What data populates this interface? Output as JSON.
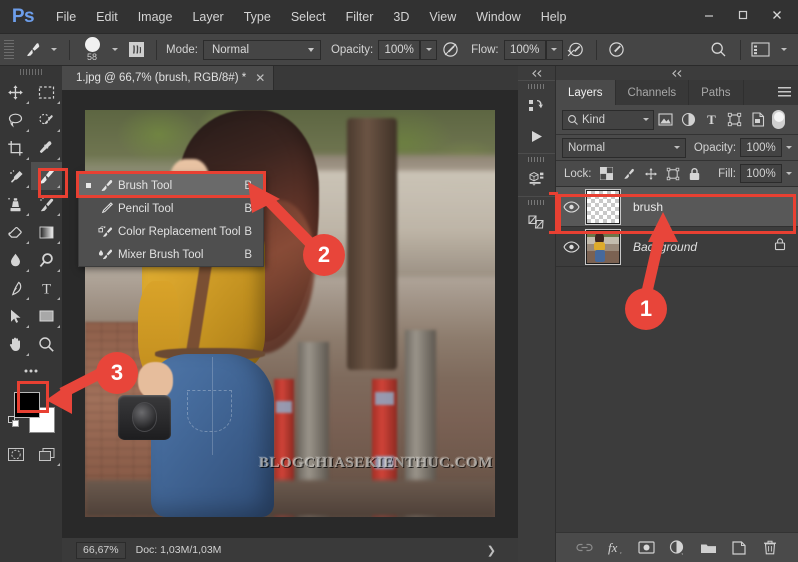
{
  "app": {
    "logo": "Ps",
    "menus": [
      "File",
      "Edit",
      "Image",
      "Layer",
      "Type",
      "Select",
      "Filter",
      "3D",
      "View",
      "Window",
      "Help"
    ],
    "window_controls": {
      "minimize": "–",
      "maximize": "□",
      "close": "✕"
    },
    "accent_red": "#e8453a",
    "panel_bg": "#3c3c3c",
    "toolbar_bg": "#363636"
  },
  "options_bar": {
    "tool_icon": "brush-tool-icon",
    "brush_size": "58",
    "brush_panel_icon": "brush-panel-icon",
    "mode_label": "Mode:",
    "mode_value": "Normal",
    "opacity_label": "Opacity:",
    "opacity_value": "100%",
    "airbrush_icon": "airbrush-icon",
    "flow_label": "Flow:",
    "flow_value": "100%",
    "smoothing_icon": "smoothing-icon",
    "tablet_pressure_icon": "tablet-pressure-icon",
    "symmetry_icon": "symmetry-icon",
    "search_icon": "search-icon",
    "workspace_icon": "workspace-switcher-icon"
  },
  "toolbar": {
    "tools": [
      {
        "name": "move-tool",
        "icon": "move-icon"
      },
      {
        "name": "rectangular-marquee-tool",
        "icon": "marquee-icon"
      },
      {
        "name": "lasso-tool",
        "icon": "lasso-icon"
      },
      {
        "name": "quick-selection-tool",
        "icon": "quick-selection-icon"
      },
      {
        "name": "crop-tool",
        "icon": "crop-icon"
      },
      {
        "name": "eyedropper-tool",
        "icon": "eyedropper-icon"
      },
      {
        "name": "spot-healing-brush-tool",
        "icon": "healing-brush-icon"
      },
      {
        "name": "brush-tool",
        "icon": "brush-icon"
      },
      {
        "name": "clone-stamp-tool",
        "icon": "clone-stamp-icon"
      },
      {
        "name": "history-brush-tool",
        "icon": "history-brush-icon"
      },
      {
        "name": "eraser-tool",
        "icon": "eraser-icon"
      },
      {
        "name": "gradient-tool",
        "icon": "gradient-icon"
      },
      {
        "name": "blur-tool",
        "icon": "blur-drop-icon"
      },
      {
        "name": "dodge-tool",
        "icon": "dodge-icon"
      },
      {
        "name": "pen-tool",
        "icon": "pen-icon"
      },
      {
        "name": "horizontal-type-tool",
        "icon": "type-T-icon"
      },
      {
        "name": "path-selection-tool",
        "icon": "path-arrow-icon"
      },
      {
        "name": "rectangle-tool",
        "icon": "rectangle-icon"
      },
      {
        "name": "hand-tool",
        "icon": "hand-icon"
      },
      {
        "name": "zoom-tool",
        "icon": "magnifier-icon"
      }
    ],
    "edit_toolbar_icon": "ellipsis-icon",
    "foreground_color": "#000000",
    "background_color": "#ffffff",
    "quick_mask_icon": "quick-mask-icon",
    "screen_mode_icon": "screen-mode-icon"
  },
  "flyout_menu": {
    "items": [
      {
        "label": "Brush Tool",
        "shortcut": "B",
        "icon": "brush-icon",
        "active": true
      },
      {
        "label": "Pencil Tool",
        "shortcut": "B",
        "icon": "pencil-icon",
        "active": false
      },
      {
        "label": "Color Replacement Tool",
        "shortcut": "B",
        "icon": "color-replacement-icon",
        "active": false
      },
      {
        "label": "Mixer Brush Tool",
        "shortcut": "B",
        "icon": "mixer-brush-icon",
        "active": false
      }
    ]
  },
  "document": {
    "tab_title": "1.jpg @ 66,7% (brush, RGB/8#) *",
    "tab_close": "✕",
    "watermark": "BLOGCHIASEKIENTHUC.COM"
  },
  "status_bar": {
    "zoom": "66,67%",
    "doc_info": "Doc: 1,03M/1,03M",
    "expand_arrow": "❯"
  },
  "dock_rail": {
    "collapse_icon": "collapse-double-chevron-icon",
    "buttons": [
      {
        "name": "libraries-icon"
      },
      {
        "name": "play-action-icon"
      },
      {
        "name": "3d-icon"
      },
      {
        "name": "adjustments-icon"
      }
    ]
  },
  "layers_panel": {
    "collapse_icon": "collapse-double-chevron-icon",
    "tabs": [
      {
        "label": "Layers",
        "active": true
      },
      {
        "label": "Channels",
        "active": false
      },
      {
        "label": "Paths",
        "active": false
      }
    ],
    "panel_menu_icon": "panel-menu-icon",
    "filter": {
      "kind_label": "Kind",
      "search_icon": "search-icon",
      "icons": [
        "pixel-filter-icon",
        "adjustment-filter-icon",
        "type-filter-icon",
        "shape-filter-icon",
        "smart-object-filter-icon"
      ],
      "toggle": "filter-enable-toggle"
    },
    "blend_mode": "Normal",
    "opacity_label": "Opacity:",
    "opacity_value": "100%",
    "lock_label": "Lock:",
    "lock_icons": [
      "lock-transparent-pixels-icon",
      "lock-image-pixels-icon",
      "lock-position-icon",
      "lock-artboard-icon",
      "lock-all-icon"
    ],
    "fill_label": "Fill:",
    "fill_value": "100%",
    "layers": [
      {
        "name": "brush",
        "thumb": "transparent-checker",
        "visible": true,
        "selected": true,
        "locked": false,
        "italic": false
      },
      {
        "name": "Background",
        "thumb": "photo",
        "visible": true,
        "selected": false,
        "locked": true,
        "italic": true
      }
    ],
    "footer_icons": [
      {
        "name": "link-layers-icon",
        "glyph": "⧉",
        "dim": true
      },
      {
        "name": "layer-style-fx-icon",
        "glyph": "fx",
        "dim": false
      },
      {
        "name": "layer-mask-icon",
        "glyph": "■",
        "dim": false
      },
      {
        "name": "new-fill-adjustment-icon",
        "glyph": "◑",
        "dim": false
      },
      {
        "name": "new-group-icon",
        "glyph": "▬",
        "dim": false
      },
      {
        "name": "new-layer-icon",
        "glyph": "⬚",
        "dim": false
      },
      {
        "name": "delete-layer-icon",
        "glyph": "Ὕ1",
        "dim": false
      }
    ]
  },
  "callouts": [
    {
      "number": "1",
      "target": "brush-layer-row"
    },
    {
      "number": "2",
      "target": "brush-tool-menu-item"
    },
    {
      "number": "3",
      "target": "foreground-color-swatch"
    }
  ]
}
